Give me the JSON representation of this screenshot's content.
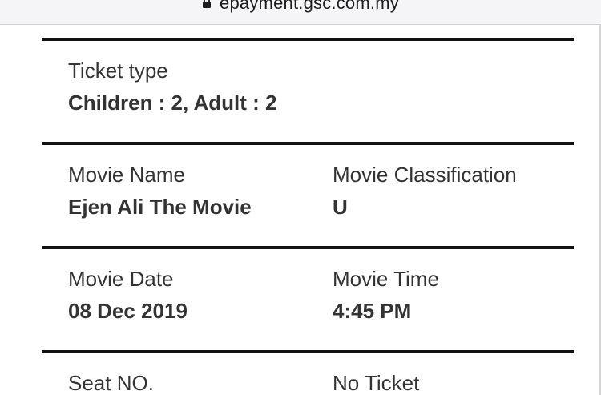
{
  "browser": {
    "url": "epayment.gsc.com.my",
    "lock_icon": "lock-icon"
  },
  "ticket": {
    "ticket_type_label": "Ticket type",
    "ticket_type_value": "Children : 2, Adult : 2",
    "movie_name_label": "Movie Name",
    "movie_name_value": "Ejen Ali The Movie",
    "classification_label": "Movie Classification",
    "classification_value": "U",
    "date_label": "Movie Date",
    "date_value": "08 Dec 2019",
    "time_label": "Movie Time",
    "time_value": "4:45 PM",
    "seat_label": "Seat NO.",
    "no_ticket_label": "No Ticket"
  }
}
